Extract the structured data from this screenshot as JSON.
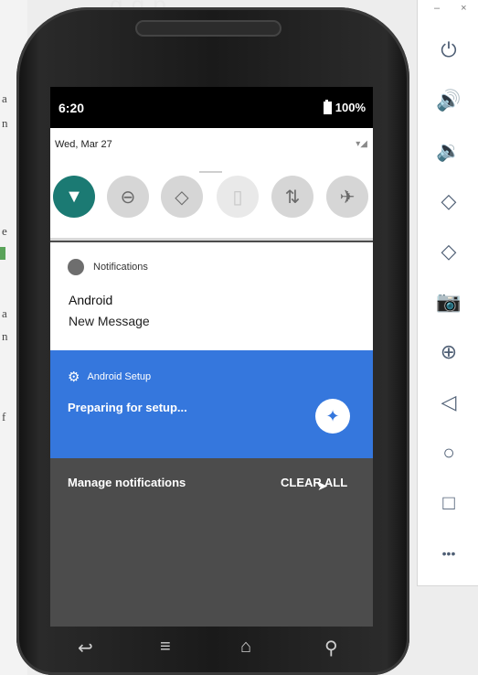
{
  "background_ide": {
    "title_fragment": "g      g  p",
    "fragments": [
      "a",
      "n",
      "e",
      "a",
      "n",
      "f"
    ]
  },
  "status_bar": {
    "time": "6:20",
    "battery": "100%"
  },
  "quick_settings": {
    "date": "Wed, Mar 27",
    "signal_glyph": "▾◢",
    "tiles": [
      {
        "icon": "wifi-off-icon",
        "glyph": "▼",
        "state": "on"
      },
      {
        "icon": "do-not-disturb-icon",
        "glyph": "⊖",
        "state": "off"
      },
      {
        "icon": "auto-rotate-icon",
        "glyph": "◇",
        "state": "off"
      },
      {
        "icon": "battery-saver-icon",
        "glyph": "▯",
        "state": "unavailable"
      },
      {
        "icon": "data-icon",
        "glyph": "⇅",
        "state": "off"
      },
      {
        "icon": "airplane-icon",
        "glyph": "✈",
        "state": "off"
      }
    ]
  },
  "notifications": {
    "header": "Notifications",
    "title": "Android",
    "text": "New Message"
  },
  "setup_notification": {
    "header": "Android Setup",
    "text": "Preparing for setup..."
  },
  "footer": {
    "manage": "Manage notifications",
    "clear_all": "CLEAR ALL"
  },
  "nav_bar": {
    "back_glyph": "↩",
    "menu_glyph": "≡",
    "home_glyph": "⌂",
    "search_glyph": "⚲"
  },
  "emulator_toolbar": {
    "window_controls": "– ×",
    "buttons": [
      {
        "name": "power",
        "glyph": "⏻"
      },
      {
        "name": "volume-up",
        "glyph": "🔊"
      },
      {
        "name": "volume-down",
        "glyph": "🔉"
      },
      {
        "name": "rotate-left",
        "glyph": "◇"
      },
      {
        "name": "rotate-right",
        "glyph": "◇"
      },
      {
        "name": "screenshot",
        "glyph": "📷"
      },
      {
        "name": "zoom",
        "glyph": "⊕"
      },
      {
        "name": "back",
        "glyph": "◁"
      },
      {
        "name": "home",
        "glyph": "○"
      },
      {
        "name": "overview",
        "glyph": "□"
      },
      {
        "name": "more",
        "glyph": "•••"
      }
    ]
  }
}
